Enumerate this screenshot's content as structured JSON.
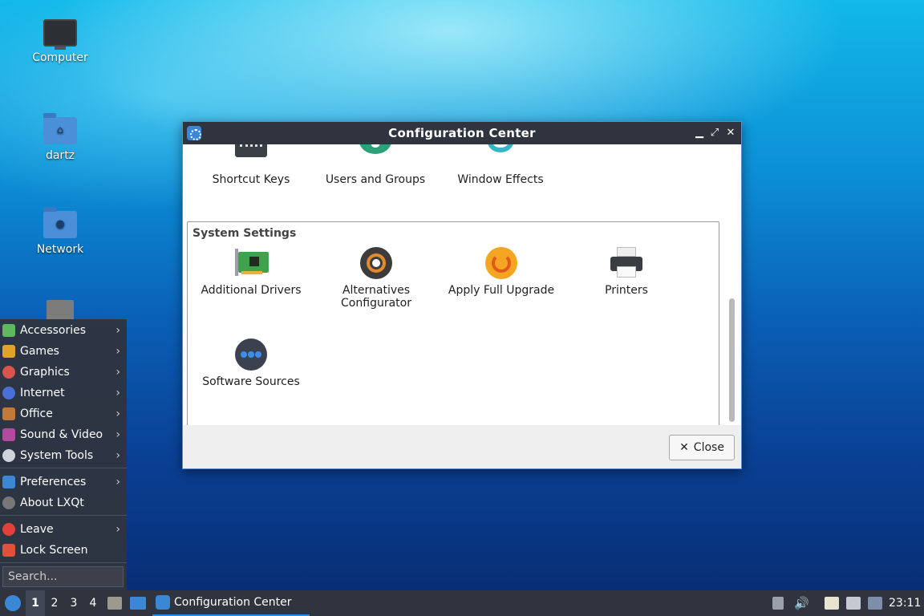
{
  "desktop": {
    "icons": [
      {
        "label": "Computer"
      },
      {
        "label": "dartz"
      },
      {
        "label": "Network"
      },
      {
        "label": ""
      }
    ]
  },
  "window": {
    "title": "Configuration Center",
    "top_items": [
      {
        "label": "Shortcut Keys",
        "icon": "keyboard-icon"
      },
      {
        "label": "Users and Groups",
        "icon": "users-icon"
      },
      {
        "label": "Window Effects",
        "icon": "window-effects-icon"
      }
    ],
    "section_title": "System Settings",
    "system_items": [
      {
        "label": "Additional Drivers",
        "icon": "driver-card-icon"
      },
      {
        "label": "Alternatives Configurator",
        "icon": "alternatives-icon"
      },
      {
        "label": "Apply Full Upgrade",
        "icon": "upgrade-icon"
      },
      {
        "label": "Printers",
        "icon": "printer-icon"
      },
      {
        "label": "Software Sources",
        "icon": "software-sources-icon"
      }
    ],
    "close_label": "Close"
  },
  "menu": {
    "items": [
      {
        "label": "Accessories",
        "color": "#5fb85f"
      },
      {
        "label": "Games",
        "color": "#e0a22b"
      },
      {
        "label": "Graphics",
        "color": "#d9534f"
      },
      {
        "label": "Internet",
        "color": "#4a6fd6"
      },
      {
        "label": "Office",
        "color": "#c27a3a"
      },
      {
        "label": "Sound & Video",
        "color": "#b24aa0"
      },
      {
        "label": "System Tools",
        "color": "#cfd3da"
      }
    ],
    "prefs": {
      "label": "Preferences"
    },
    "about": {
      "label": "About LXQt"
    },
    "leave": {
      "label": "Leave"
    },
    "lock": {
      "label": "Lock Screen"
    },
    "search_placeholder": "Search..."
  },
  "taskbar": {
    "workspaces": [
      "1",
      "2",
      "3",
      "4"
    ],
    "task_label": "Configuration Center",
    "clock": "23:11"
  },
  "colors": {
    "accent": "#3a87d6",
    "panel": "#2f343f"
  }
}
